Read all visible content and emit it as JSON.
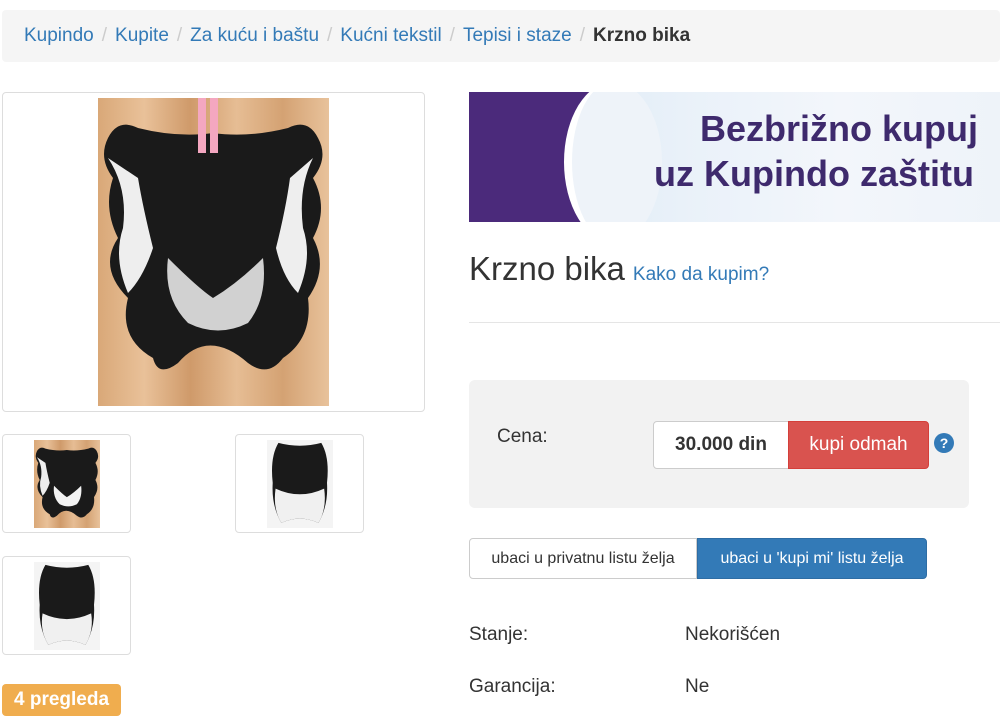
{
  "breadcrumb": {
    "items": [
      "Kupindo",
      "Kupite",
      "Za kuću i baštu",
      "Kućni tekstil",
      "Tepisi i staze"
    ],
    "current": "Krzno bika",
    "separator": "/"
  },
  "gallery": {
    "main_image": "cowhide-rug-photo",
    "thumbnails": [
      "cowhide-rug-thumb-1",
      "cowhide-rug-thumb-2",
      "cowhide-rug-thumb-3"
    ]
  },
  "views": "4 pregleda",
  "banner": {
    "line1": "Bezbrižno kupuj",
    "line2": "uz Kupindo zaštitu",
    "accent_color": "#4b2a7b"
  },
  "product": {
    "title": "Krzno bika",
    "how_to_buy": "Kako da kupim?"
  },
  "price": {
    "label": "Cena:",
    "value": "30.000 din",
    "buy_label": "kupi odmah",
    "help_icon": "?"
  },
  "wishlist": {
    "private_label": "ubaci u privatnu listu želja",
    "kupimi_label": "ubaci u 'kupi mi' listu želja"
  },
  "attributes": [
    {
      "label": "Stanje:",
      "value": "Nekorišćen"
    },
    {
      "label": "Garancija:",
      "value": "Ne"
    }
  ],
  "colors": {
    "link": "#337ab7",
    "buy": "#d9534f",
    "badge": "#f0ad4e"
  }
}
